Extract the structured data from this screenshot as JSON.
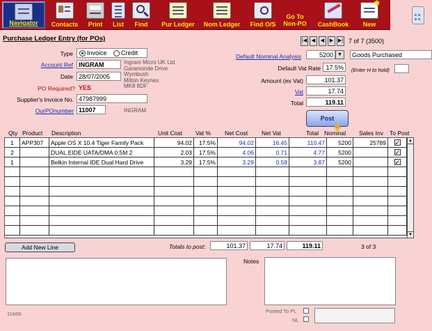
{
  "toolbar": {
    "items": [
      {
        "label": "Navigator"
      },
      {
        "label": "Contacts"
      },
      {
        "label": "Print"
      },
      {
        "label": "List"
      },
      {
        "label": "Find"
      },
      {
        "label": "Pur Ledger"
      },
      {
        "label": "Nom Ledger"
      },
      {
        "label": "Find O/S"
      },
      {
        "label": "Go To\nNon-PO"
      },
      {
        "label": "CashBook"
      },
      {
        "label": "New"
      }
    ]
  },
  "page_title": "Purchase Ledger Entry (for POs)",
  "record_nav": {
    "position": "7 of 7 (3500)"
  },
  "form": {
    "type_label": "Type",
    "type_options": [
      "Invoice",
      "Credit"
    ],
    "account_ref_label": "Account Ref",
    "account_ref": "INGRAM",
    "address": [
      "Ingram Micro UK Ltd",
      "Garamonde Drive",
      "Wymbush",
      "Milton Keynes",
      "MK8 8DF"
    ],
    "date_label": "Date",
    "date": "28/07/2005",
    "po_required_label": "PO Required?",
    "po_required": "YES",
    "supplier_invoice_label": "Supplier's Invoice  No.",
    "supplier_invoice": "47987999",
    "our_po_label": "OurPOnumber",
    "our_po": "11007",
    "our_po_supplier": "INGRAM",
    "default_nominal_label": "Default Nominal Analysis",
    "default_nominal": "5200",
    "default_nominal_desc": "Goods Purchased",
    "default_vat_label": "Default Vat Rate",
    "default_vat": "17.5%",
    "enter_h_hint": "(Enter H to hold)",
    "amount_label": "Amount (ex Vat)",
    "amount": "101.37",
    "vat_label": "Vat",
    "vat": "17.74",
    "total_label": "Total",
    "total": "119.11",
    "post_label": "Post"
  },
  "grid": {
    "headers": [
      "Qty",
      "Product",
      "Description",
      "Unit Cost",
      "Vat %",
      "Net Cost",
      "Net Vat",
      "Total",
      "Nominal",
      "Sales Inv",
      "To Post"
    ],
    "rows": [
      [
        "1",
        "APP307",
        "Apple OS X 10.4 Tiger Family Pack",
        "94.02",
        "17.5%",
        "94.02",
        "16.45",
        "110.47",
        "5200",
        "25789",
        "✓"
      ],
      [
        "2",
        "",
        "DUAL EIDE UATA/DMA 0.5M 2",
        "2.03",
        "17.5%",
        "4.06",
        "0.71",
        "4.77",
        "5200",
        "",
        "✓"
      ],
      [
        "1",
        "",
        "Belkin Internal IDE Dual Hard Drive",
        "3.29",
        "17.5%",
        "3.29",
        "0.58",
        "3.87",
        "5200",
        "",
        "✓"
      ]
    ]
  },
  "footer": {
    "add_line_label": "Add  New  Line",
    "totals_label": "Totals to post:",
    "totals_net": "101.37",
    "totals_vat": "17.74",
    "totals_total": "119.11",
    "page_count": "3 of 3",
    "notes_label": "Notes",
    "record_id": "11669",
    "posted_pl_label": "Posted To PL",
    "nl_label": "NL"
  }
}
